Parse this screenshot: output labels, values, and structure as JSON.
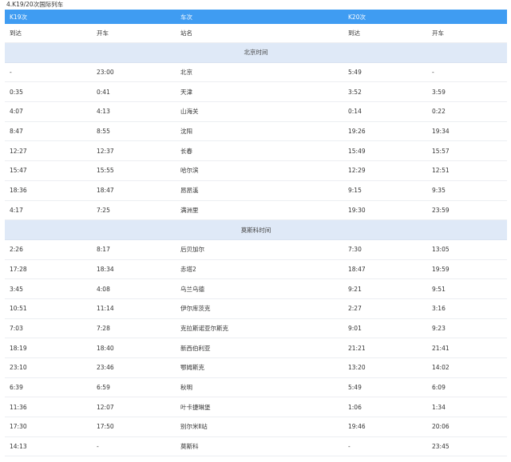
{
  "caption": "4.K19/20次国际列车",
  "header": {
    "col1": "K19次",
    "col3": "车次",
    "col4": "K20次"
  },
  "subheader": {
    "arrive1": "到达",
    "depart1": "开车",
    "station": "站名",
    "arrive2": "到达",
    "depart2": "开车"
  },
  "sections": [
    {
      "title": "北京时间",
      "rows": [
        [
          "-",
          "23:00",
          "北京",
          "5:49",
          "-"
        ],
        [
          "0:35",
          "0:41",
          "天津",
          "3:52",
          "3:59"
        ],
        [
          "4:07",
          "4:13",
          "山海关",
          "0:14",
          "0:22"
        ],
        [
          "8:47",
          "8:55",
          "沈阳",
          "19:26",
          "19:34"
        ],
        [
          "12:27",
          "12:37",
          "长春",
          "15:49",
          "15:57"
        ],
        [
          "15:47",
          "15:55",
          "哈尔滨",
          "12:29",
          "12:51"
        ],
        [
          "18:36",
          "18:47",
          "昂昂溪",
          "9:15",
          "9:35"
        ],
        [
          "4:17",
          "7:25",
          "满洲里",
          "19:30",
          "23:59"
        ]
      ]
    },
    {
      "title": "莫斯科时间",
      "rows": [
        [
          "2:26",
          "8:17",
          "后贝加尔",
          "7:30",
          "13:05"
        ],
        [
          "17:28",
          "18:34",
          "赤塔2",
          "18:47",
          "19:59"
        ],
        [
          "3:45",
          "4:08",
          "乌兰乌德",
          "9:21",
          "9:51"
        ],
        [
          "10:51",
          "11:14",
          "伊尔库茨克",
          "2:27",
          "3:16"
        ],
        [
          "7:03",
          "7:28",
          "克拉斯诺亚尔斯克",
          "9:01",
          "9:23"
        ],
        [
          "18:19",
          "18:40",
          "新西伯利亚",
          "21:21",
          "21:41"
        ],
        [
          "23:10",
          "23:46",
          "鄂姆斯克",
          "13:20",
          "14:02"
        ],
        [
          "6:39",
          "6:59",
          "秋明",
          "5:49",
          "6:09"
        ],
        [
          "11:36",
          "12:07",
          "叶卡捷琳堡",
          "1:06",
          "1:34"
        ],
        [
          "17:30",
          "17:50",
          "别尔米Ⅱ站",
          "19:46",
          "20:06"
        ],
        [
          "14:13",
          "-",
          "莫斯科",
          "-",
          "23:45"
        ]
      ]
    }
  ]
}
